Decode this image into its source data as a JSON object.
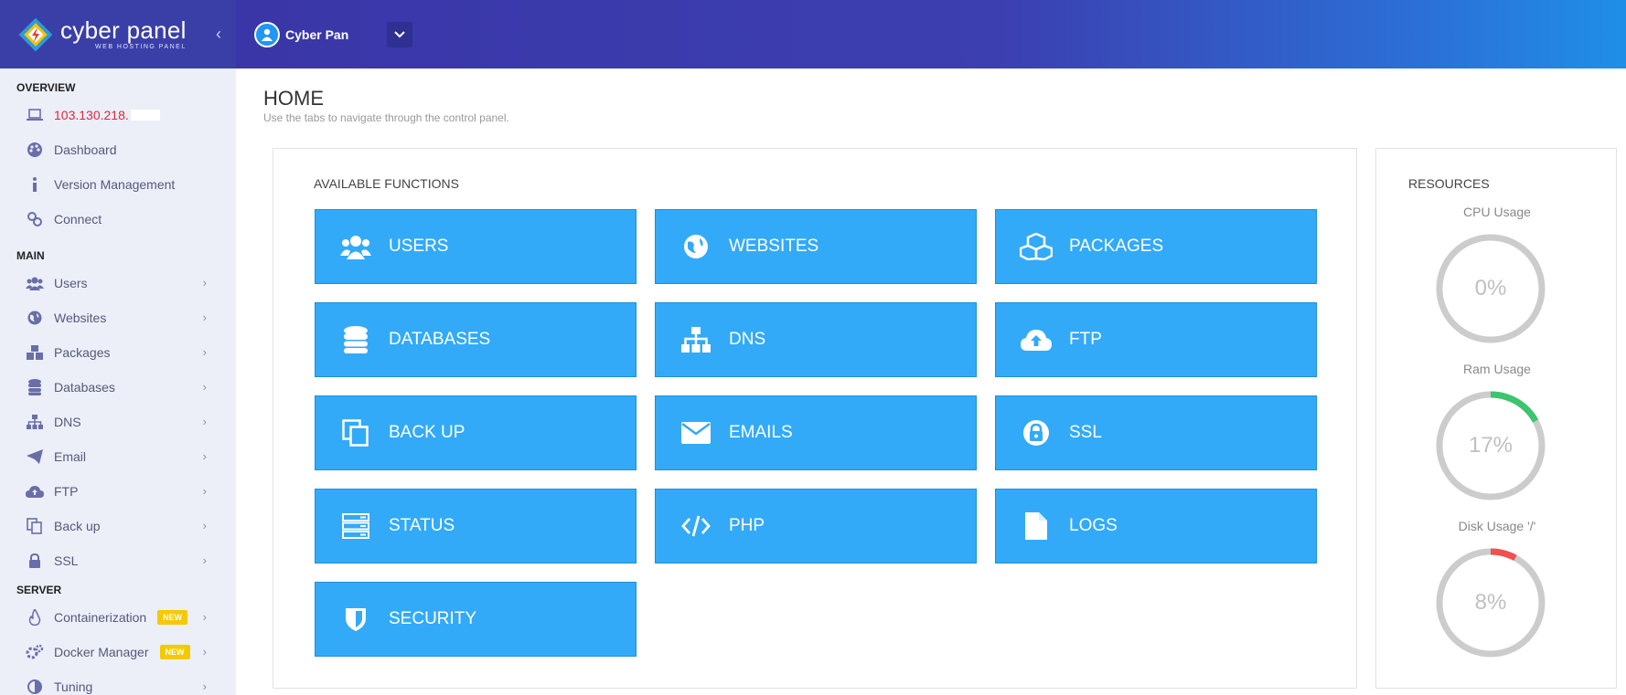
{
  "brand": {
    "name": "cyber panel",
    "sub": "WEB HOSTING PANEL",
    "collapse_icon": "chevron-left-icon"
  },
  "topbar": {
    "user": "Cyber Pan",
    "dropdown_icon": "chevron-down-icon"
  },
  "sidebar": {
    "overview_heading": "OVERVIEW",
    "ip": "103.130.218.",
    "overview": [
      {
        "label": "Dashboard"
      },
      {
        "label": "Version Management"
      },
      {
        "label": "Connect"
      }
    ],
    "main_heading": "MAIN",
    "main": [
      {
        "label": "Users"
      },
      {
        "label": "Websites"
      },
      {
        "label": "Packages"
      },
      {
        "label": "Databases"
      },
      {
        "label": "DNS"
      },
      {
        "label": "Email"
      },
      {
        "label": "FTP"
      },
      {
        "label": "Back up"
      },
      {
        "label": "SSL"
      }
    ],
    "server_heading": "SERVER",
    "server": [
      {
        "label": "Containerization",
        "badge": "NEW"
      },
      {
        "label": "Docker Manager",
        "badge": "NEW"
      },
      {
        "label": "Tuning"
      }
    ]
  },
  "page": {
    "title": "HOME",
    "subtitle": "Use the tabs to navigate through the control panel."
  },
  "functions": {
    "heading": "AVAILABLE FUNCTIONS",
    "tiles": [
      {
        "label": "USERS",
        "icon": "users-icon"
      },
      {
        "label": "WEBSITES",
        "icon": "globe-icon"
      },
      {
        "label": "PACKAGES",
        "icon": "cubes-icon"
      },
      {
        "label": "DATABASES",
        "icon": "database-icon"
      },
      {
        "label": "DNS",
        "icon": "sitemap-icon"
      },
      {
        "label": "FTP",
        "icon": "cloud-upload-icon"
      },
      {
        "label": "BACK UP",
        "icon": "copy-icon"
      },
      {
        "label": "EMAILS",
        "icon": "envelope-icon"
      },
      {
        "label": "SSL",
        "icon": "lock-icon"
      },
      {
        "label": "STATUS",
        "icon": "server-icon"
      },
      {
        "label": "PHP",
        "icon": "code-icon"
      },
      {
        "label": "LOGS",
        "icon": "file-icon"
      },
      {
        "label": "SECURITY",
        "icon": "shield-icon"
      }
    ]
  },
  "resources": {
    "heading": "RESOURCES",
    "items": [
      {
        "label": "CPU Usage",
        "value": "0%",
        "fraction": 0,
        "color": "#cccccc"
      },
      {
        "label": "Ram Usage",
        "value": "17%",
        "fraction": 0.17,
        "color": "#3cc46e"
      },
      {
        "label": "Disk Usage '/'",
        "value": "8%",
        "fraction": 0.08,
        "color": "#f05050"
      }
    ]
  },
  "colors": {
    "tile": "#33aaf8",
    "sidebar_bg": "#eceff8",
    "topbar": "#3a36a8",
    "ip": "#e0263a"
  }
}
